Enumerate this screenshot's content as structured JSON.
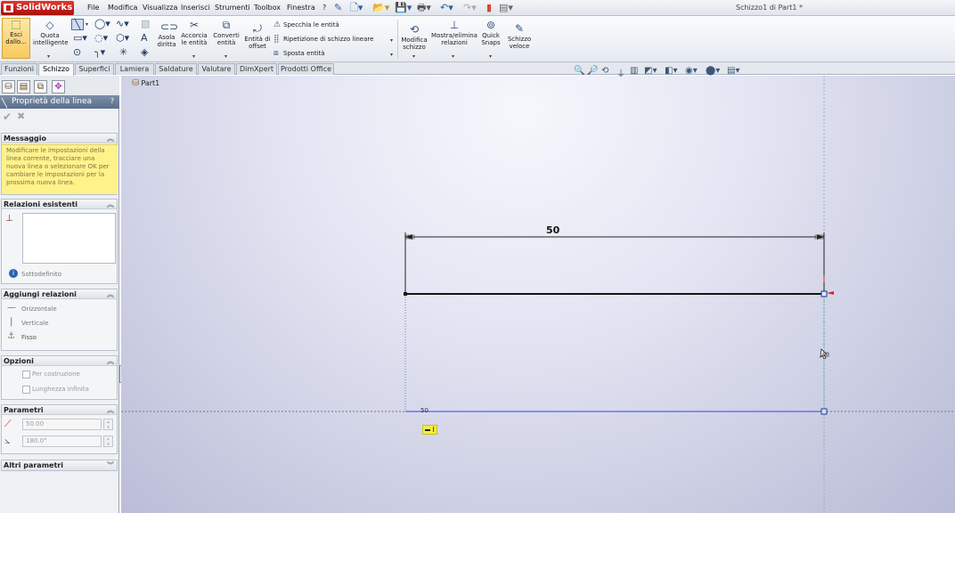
{
  "app": {
    "name": "SolidWorks",
    "document_title": "Schizzo1 di Part1 *"
  },
  "menu": [
    "File",
    "Modifica",
    "Visualizza",
    "Inserisci",
    "Strumenti",
    "Toolbox",
    "Finestra",
    "?"
  ],
  "commands": {
    "exit_sketch": [
      "Esci",
      "dallo..."
    ],
    "smart_dimension": [
      "Quota",
      "intelligente"
    ],
    "slot": [
      "Asola",
      "diritta"
    ],
    "trim": [
      "Accorcia",
      "le entità"
    ],
    "convert": [
      "Converti",
      "entità"
    ],
    "offset": [
      "Entità di",
      "offset"
    ],
    "mirror": "Specchia le entità",
    "linear_pattern": "Ripetizione di schizzo lineare",
    "move": "Sposta entità",
    "repair_sketch": [
      "Modifica",
      "schizzo"
    ],
    "relations": [
      "Mostra/elimina",
      "relazioni"
    ],
    "quick_snaps": [
      "Quick",
      "Snaps"
    ],
    "rapid_sketch": [
      "Schizzo",
      "veloce"
    ]
  },
  "tabs": [
    "Funzioni",
    "Schizzo",
    "Superfici",
    "Lamiera",
    "Saldature",
    "Valutare",
    "DimXpert",
    "Prodotti Office"
  ],
  "active_tab": "Schizzo",
  "property_manager": {
    "title": "Proprietà della linea",
    "help": "?",
    "messaggio": {
      "header": "Messaggio",
      "text": "Modificare le impostazioni della linea corrente, tracciare una nuova linea o selezionare OK per cambiare le impostazioni per la prossima nuova linea."
    },
    "relazioni_esistenti": {
      "header": "Relazioni esistenti",
      "status": "Sottodefinito"
    },
    "aggiungi_relazioni": {
      "header": "Aggiungi relazioni",
      "items": [
        "Orizzontale",
        "Verticale",
        "Fisso"
      ]
    },
    "opzioni": {
      "header": "Opzioni",
      "items": [
        "Per costruzione",
        "Lunghezza infinita"
      ]
    },
    "parametri": {
      "header": "Parametri",
      "length": "50.00",
      "angle": "180.0°"
    },
    "altri_parametri": {
      "header": "Altri parametri"
    }
  },
  "graphics": {
    "tree_root": "Part1",
    "dimension_main": "50",
    "dimension_preview": "50",
    "cursor_badge": "I"
  }
}
